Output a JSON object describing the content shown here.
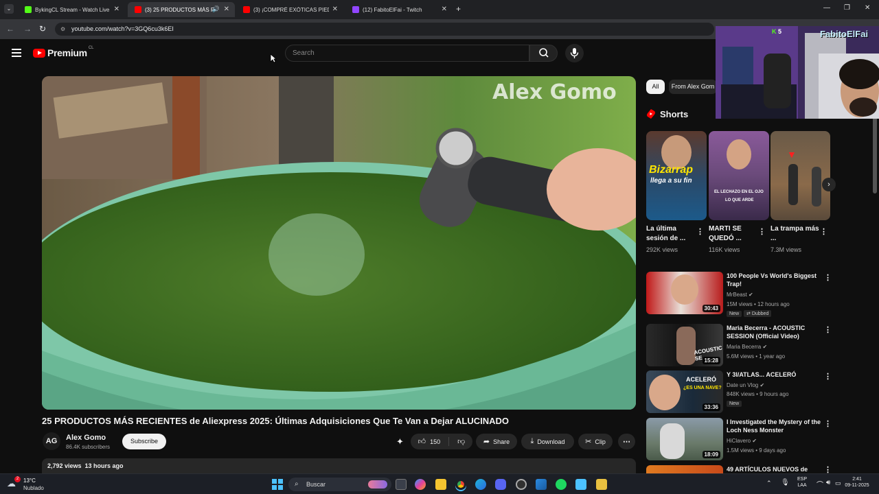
{
  "browser": {
    "tabs": [
      {
        "label": "BykingCL Stream - Watch Live o",
        "color": "#53fc18"
      },
      {
        "label": "(3) 25 PRODUCTOS MÁS RE",
        "color": "#ff0000"
      },
      {
        "label": "(3) ¡COMPRÉ EXÓTICAS PIEDRA",
        "color": "#ff0000"
      },
      {
        "label": "(12) FabitoElFai - Twitch",
        "color": "#9146ff"
      }
    ],
    "url": "youtube.com/watch?v=3GQ6cu3k6EI"
  },
  "youtube": {
    "logo_text": "Premium",
    "country_code": "CL",
    "search_placeholder": "Search",
    "video": {
      "watermark": "Alex Gomo",
      "title": "25 PRODUCTOS MÁS RECIENTES de Aliexpress 2025: Últimas Adquisiciones Que Te Van a Dejar ALUCINADO",
      "channel_initials": "AG",
      "channel": "Alex Gomo",
      "subscribers": "86.4K subscribers",
      "subscribe_label": "Subscribe",
      "likes": "150",
      "share_label": "Share",
      "download_label": "Download",
      "clip_label": "Clip",
      "meta": "2,792 views  13 hours ago"
    },
    "chips": [
      "All",
      "From Alex Gom"
    ],
    "shorts_label": "Shorts",
    "shorts": [
      {
        "title": "La última sesión de ...",
        "views": "292K views",
        "overlay": "Bizarrap",
        "overlay2": "llega a su fin"
      },
      {
        "title": "MARTI SE QUEDÓ ...",
        "views": "116K views",
        "overlay": "EL LECHAZO EN EL OJO",
        "overlay2": "LO QUE ARDE"
      },
      {
        "title": "La trampa más ...",
        "views": "7.3M views",
        "overlay": "",
        "overlay2": ""
      }
    ],
    "recommended": [
      {
        "title": "100 People Vs World's Biggest Trap!",
        "channel": "MrBeast",
        "meta": "15M views • 12 hours ago",
        "duration": "30:43",
        "badges": [
          "New",
          "Dubbed"
        ]
      },
      {
        "title": "Maria Becerra - ACOUSTIC SESSION (Official Video)",
        "channel": "Maria Becerra",
        "meta": "5.6M views • 1 year ago",
        "duration": "15:28",
        "badges": []
      },
      {
        "title": "Y 3I/ATLAS... ACELERÓ",
        "channel": "Date un Vlog",
        "meta": "848K views • 9 hours ago",
        "duration": "33:36",
        "badges": [
          "New"
        ]
      },
      {
        "title": "I Investigated the Mystery of the Loch Ness Monster",
        "channel": "HiClavero",
        "meta": "1.5M views • 9 days ago",
        "duration": "18:09",
        "badges": []
      },
      {
        "title": "49 ARTÍCULOS NUEVOS de",
        "channel": "",
        "meta": "",
        "duration": "",
        "badges": []
      }
    ],
    "thumb_text": {
      "acoustic": "ACOUSTIC SE",
      "acelero": "ACELERÓ",
      "acelero2": "¿ES UNA NAVE?"
    }
  },
  "stream_overlay": {
    "name": "FabitoElFai",
    "count": "5"
  },
  "taskbar": {
    "weather_temp": "13°C",
    "weather_desc": "Nublado",
    "weather_badge": "2",
    "search_label": "Buscar",
    "lang1": "ESP",
    "lang2": "LAA",
    "time": "2:41",
    "date": "09-11-2025"
  }
}
